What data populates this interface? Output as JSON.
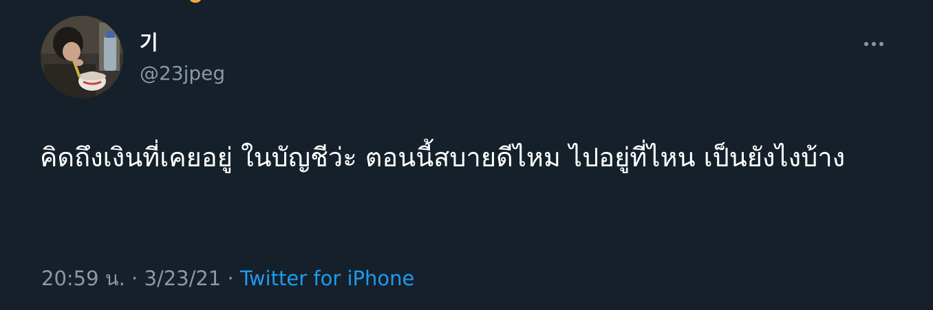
{
  "tweet": {
    "display_name": "기",
    "handle": "@23jpeg",
    "text": "คิดถึงเงินที่เคยอยู่ ในบัญชีว่ะ ตอนนี้สบายดีไหม ไปอยู่ที่ไหน เป็นยังไงบ้าง",
    "time": "20:59 น.",
    "separator": " · ",
    "date": "3/23/21",
    "source": "Twitter for iPhone"
  },
  "icons": {
    "more": "more-horizontal-icon",
    "avatar": "profile-photo"
  },
  "colors": {
    "background": "#15202b",
    "text_primary": "#ffffff",
    "text_secondary": "#8b98a5",
    "link": "#1d9bf0"
  }
}
